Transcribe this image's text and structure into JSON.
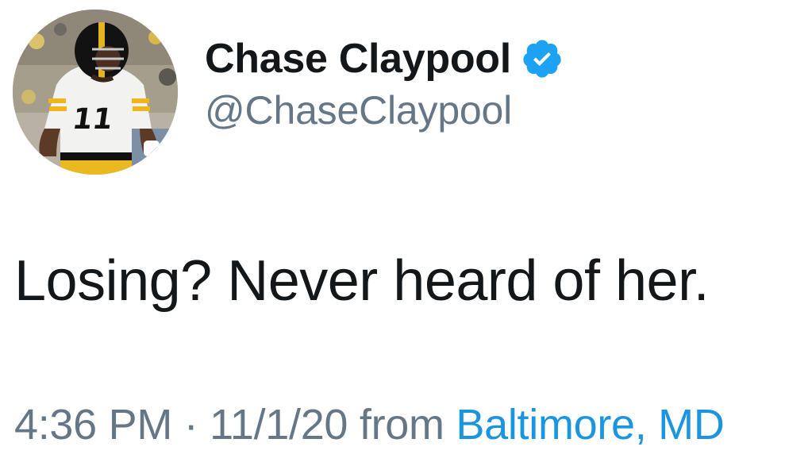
{
  "user": {
    "display_name": "Chase Claypool",
    "handle": "@ChaseClaypool",
    "verified": true,
    "avatar_icon": "player-photo-avatar"
  },
  "tweet": {
    "text": "Losing? Never heard of her."
  },
  "meta": {
    "time": "4:36 PM",
    "separator": "·",
    "date": "11/1/20",
    "from_label": "from",
    "location": "Baltimore, MD"
  },
  "colors": {
    "text_primary": "#14171a",
    "text_secondary": "#657786",
    "link": "#1b95e0",
    "verified_badge": "#1da1f2"
  }
}
